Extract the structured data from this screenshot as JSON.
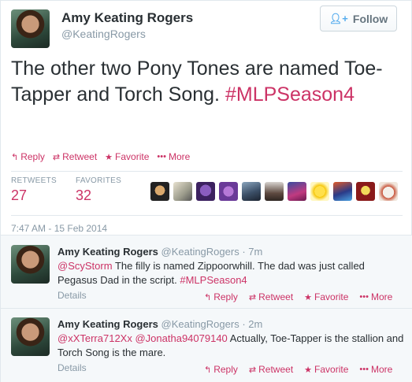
{
  "tweet": {
    "name": "Amy Keating Rogers",
    "handle": "@KeatingRogers",
    "follow_label": "Follow",
    "text": "The other two Pony Tones are named Toe-Tapper and Torch Song.",
    "hashtag": "#MLPSeason4",
    "actions": {
      "reply": "Reply",
      "retweet": "Retweet",
      "favorite": "Favorite",
      "more": "More"
    },
    "retweets_label": "RETWEETS",
    "retweets": "27",
    "favorites_label": "FAVORITES",
    "favorites": "32",
    "timestamp": "7:47 AM - 15 Feb 2014"
  },
  "replies": [
    {
      "name": "Amy Keating Rogers",
      "handle": "@KeatingRogers",
      "sep": "·",
      "time": "7m",
      "mention": "@ScyStorm",
      "text": "The filly is named Zippoorwhill.  The dad was just called Pegasus Dad in the script.",
      "hashtag": "#MLPSeason4",
      "details": "Details",
      "reply": "Reply",
      "retweet": "Retweet",
      "favorite": "Favorite",
      "more": "More"
    },
    {
      "name": "Amy Keating Rogers",
      "handle": "@KeatingRogers",
      "sep": "·",
      "time": "2m",
      "mention1": "@xXTerra712Xx",
      "mention2": "@Jonatha94079140",
      "text": "Actually, Toe-Tapper is the stallion and Torch Song is the mare.",
      "details": "Details",
      "reply": "Reply",
      "retweet": "Retweet",
      "favorite": "Favorite",
      "more": "More"
    }
  ],
  "colors": {
    "accent": "#cc3366",
    "follow_icon": "#55acee",
    "muted": "#8899a6"
  },
  "icons": {
    "reply": "reply-icon",
    "retweet": "retweet-icon",
    "favorite": "star-icon",
    "more": "dots-icon",
    "follow": "add-user-icon"
  }
}
